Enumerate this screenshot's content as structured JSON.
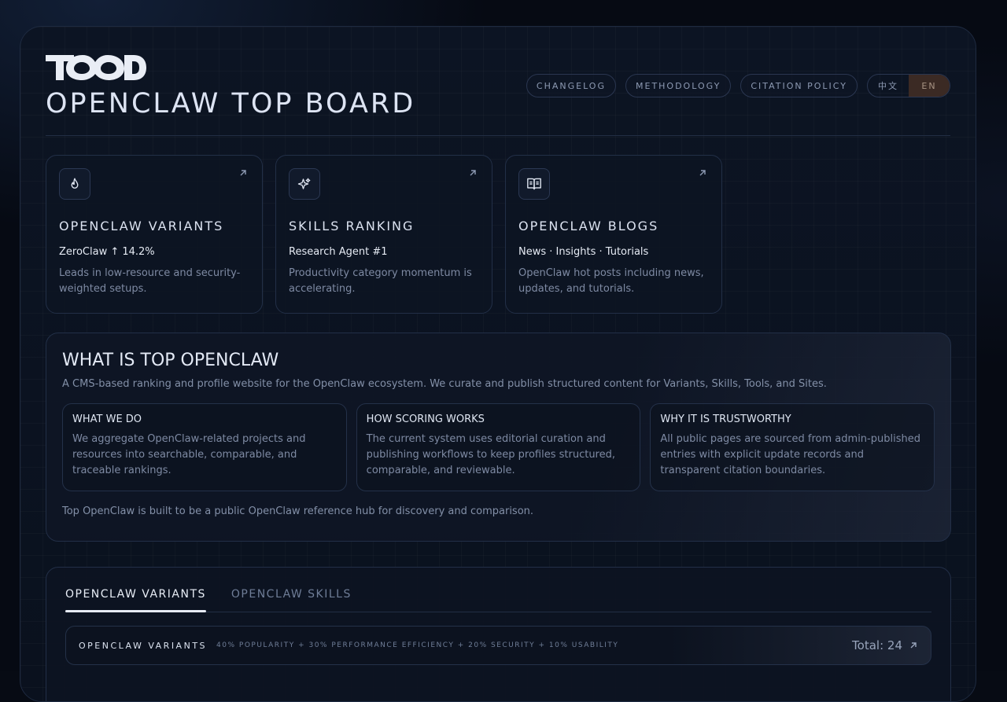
{
  "header": {
    "logo_text": "TOOD",
    "title": "OPENCLAW TOP BOARD",
    "nav": [
      "CHANGELOG",
      "METHODOLOGY",
      "CITATION POLICY"
    ],
    "lang": {
      "zh": "中文",
      "en": "EN",
      "active": "en"
    }
  },
  "cards": [
    {
      "icon": "flame-icon",
      "title": "OPENCLAW VARIANTS",
      "subtitle": "ZeroClaw ↑ 14.2%",
      "desc": "Leads in low-resource and security-weighted setups."
    },
    {
      "icon": "sparkles-icon",
      "title": "SKILLS RANKING",
      "subtitle": "Research Agent #1",
      "desc": "Productivity category momentum is accelerating."
    },
    {
      "icon": "book-open-icon",
      "title": "OPENCLAW BLOGS",
      "subtitle": "News · Insights · Tutorials",
      "desc": "OpenClaw hot posts including news, updates, and tutorials."
    }
  ],
  "about": {
    "title": "WHAT IS TOP OPENCLAW",
    "lead": "A CMS-based ranking and profile website for the OpenClaw ecosystem. We curate and publish structured content for Variants, Skills, Tools, and Sites.",
    "features": [
      {
        "title": "WHAT WE DO",
        "desc": "We aggregate OpenClaw-related projects and resources into searchable, comparable, and traceable rankings."
      },
      {
        "title": "HOW SCORING WORKS",
        "desc": "The current system uses editorial curation and publishing workflows to keep profiles structured, comparable, and reviewable."
      },
      {
        "title": "WHY IT IS TRUSTWORTHY",
        "desc": "All public pages are sourced from admin-published entries with explicit update records and transparent citation boundaries."
      }
    ],
    "footer": "Top OpenClaw is built to be a public OpenClaw reference hub for discovery and comparison."
  },
  "tabs": {
    "items": [
      "OPENCLAW VARIANTS",
      "OPENCLAW SKILLS"
    ],
    "active": 0
  },
  "variants_bar": {
    "title": "OPENCLAW VARIANTS",
    "formula": "40% POPULARITY + 30% PERFORMANCE EFFICIENCY + 20% SECURITY + 10% USABILITY",
    "total": "Total: 24"
  },
  "colors": {
    "background": "#060a13",
    "panel": "#0d1422",
    "border": "#222f47",
    "accent_lang": "#3b2a24"
  }
}
